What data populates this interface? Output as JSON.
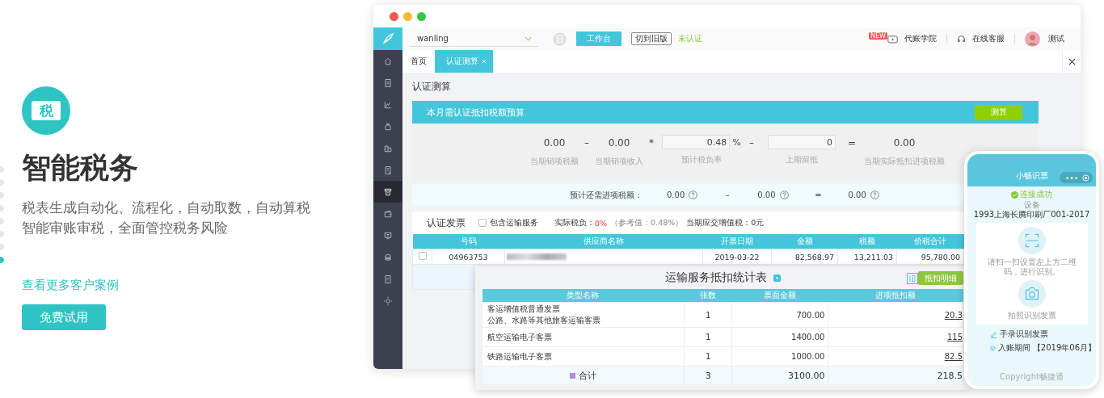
{
  "pager_dots": [
    {
      "selected": false
    },
    {
      "selected": false
    },
    {
      "selected": false
    },
    {
      "selected": false
    },
    {
      "selected": false
    },
    {
      "selected": false
    },
    {
      "selected": false
    },
    {
      "selected": true
    }
  ],
  "hero": {
    "logo_glyph": "税",
    "title": "智能税务",
    "description": [
      "税表生成自动化、流程化，自动取数，自动算税",
      "智能审账审税，全面管控税务风险"
    ],
    "link": "查看更多客户案例",
    "button": "免费试用"
  },
  "app": {
    "sidebar": [
      {
        "selected": false
      },
      {
        "selected": false
      },
      {
        "selected": false
      },
      {
        "selected": false
      },
      {
        "selected": false
      },
      {
        "selected": false
      },
      {
        "selected": true
      },
      {
        "selected": false
      },
      {
        "selected": false
      },
      {
        "selected": false
      },
      {
        "selected": false
      },
      {
        "selected": false
      }
    ],
    "company_select": {
      "value": "wanling"
    },
    "workbench_button": "工作台",
    "old_version_button": "切到旧版",
    "status": "未认证",
    "academy": {
      "badge": "NEW",
      "label": "代账学院"
    },
    "support": "在线客服",
    "user_name": "测试",
    "tabs": [
      {
        "label": "首页",
        "selected": false,
        "closable": false
      },
      {
        "label": "认证测算",
        "selected": true,
        "closable": true
      }
    ],
    "page_title": "认证测算",
    "budget": {
      "title": "本月需认证抵扣税额预算",
      "button": "测算",
      "terms": [
        {
          "kind": "value",
          "value": "0.00",
          "label": "当期销项税额"
        },
        {
          "kind": "operator",
          "symbol": "–"
        },
        {
          "kind": "value",
          "value": "0.00",
          "label": "当期销项收入"
        },
        {
          "kind": "operator",
          "symbol": "*"
        },
        {
          "kind": "input",
          "value": "0.48",
          "unit": "%",
          "label": "预计税负率"
        },
        {
          "kind": "operator",
          "symbol": "–"
        },
        {
          "kind": "input",
          "value": "0",
          "label": "上期留抵"
        },
        {
          "kind": "operator",
          "symbol": "="
        },
        {
          "kind": "value",
          "value": "0.00",
          "label": "当期实际抵扣进项税额"
        }
      ],
      "estimate_label": "预计还需进项税额：",
      "estimate": [
        {
          "kind": "value",
          "value": "0.00"
        },
        {
          "kind": "operator",
          "symbol": "–"
        },
        {
          "kind": "value",
          "value": "0.00"
        },
        {
          "kind": "operator",
          "symbol": "="
        },
        {
          "kind": "value",
          "value": "0.00"
        }
      ]
    },
    "invoices": {
      "title": "认证发票",
      "transport": {
        "label": "包含运输服务",
        "checked": false
      },
      "burden_label": "实际税负：",
      "burden_value": "0%",
      "reference": "（参考值：0.48%）",
      "vat": "当期应交增值税：0元",
      "columns": [
        "号码",
        "供应商名称",
        "开票日期",
        "金额",
        "税额",
        "价税合计"
      ],
      "rows": [
        {
          "checked": false,
          "number": "04963753",
          "date": "2019-03-22",
          "amount": "82,568.97",
          "tax": "13,211.03",
          "total": "95,780.00"
        }
      ]
    }
  },
  "modal": {
    "title": "运输服务抵扣统计表",
    "button": "抵扣明细",
    "columns": [
      "类型名称",
      "张数",
      "票面金额",
      "进项抵扣额"
    ],
    "rows": [
      {
        "names": [
          "客运增值税普通发票",
          "公路、水路等其他旅客运输客票"
        ],
        "count": "1",
        "amount": "700.00",
        "deduction": "20.3"
      },
      {
        "names": [
          "航空运输电子客票"
        ],
        "count": "1",
        "amount": "1400.00",
        "deduction": "115"
      },
      {
        "names": [
          "铁路运输电子客票"
        ],
        "count": "1",
        "amount": "1000.00",
        "deduction": "82.5"
      }
    ],
    "total": {
      "label": "合计",
      "count": "3",
      "amount": "3100.00",
      "deduction": "218.5"
    }
  },
  "phone": {
    "title": "小畅识票",
    "status": "连接成功",
    "device_label": "设备",
    "device": "1993上海长腾印刷厂001-2017",
    "scan_hint": "请扫一扫设置左上方二维码，进行识别。",
    "photo_label": "拍照识别发票",
    "manual": "手录识别发票",
    "period": "入账期间 【2019年06月】",
    "copyright": "Copyright畅捷通"
  }
}
